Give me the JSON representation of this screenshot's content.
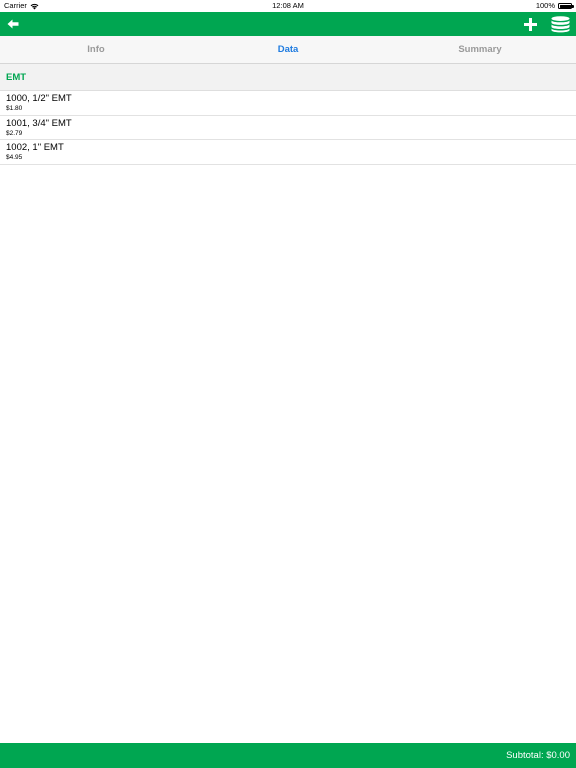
{
  "status_bar": {
    "carrier": "Carrier",
    "time": "12:08 AM",
    "battery_percent": "100%",
    "battery_level": 1.0
  },
  "nav_bar": {
    "color": "#00a651",
    "icons": [
      "arrow-left-icon",
      "plus-icon",
      "database-icon"
    ]
  },
  "tabs": {
    "items": [
      "Info",
      "Data",
      "Summary"
    ],
    "active": "Data",
    "active_color": "#1e7be0"
  },
  "section": {
    "title": "EMT",
    "title_color": "#00a651"
  },
  "items": [
    {
      "title": "1000, 1/2\" EMT",
      "price": "$1.80"
    },
    {
      "title": "1001, 3/4\" EMT",
      "price": "$2.79"
    },
    {
      "title": "1002, 1\" EMT",
      "price": "$4.95"
    }
  ],
  "footer": {
    "subtotal": "Subtotal: $0.00"
  }
}
